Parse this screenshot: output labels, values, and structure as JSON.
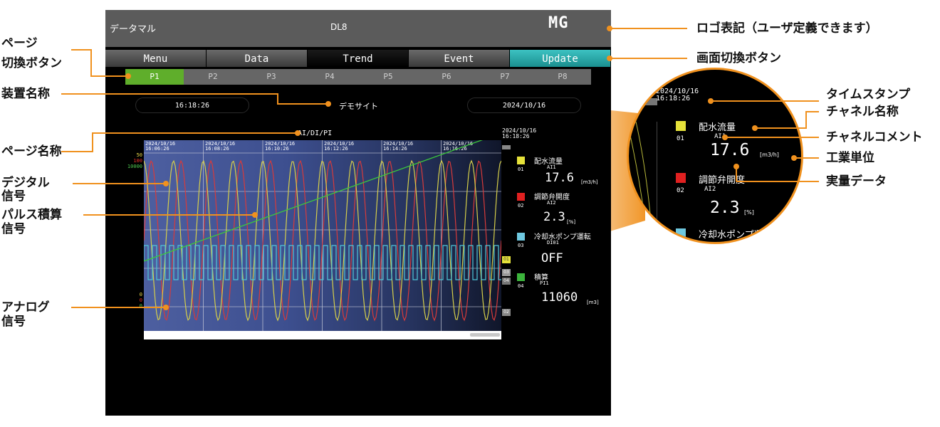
{
  "screen": {
    "app_name": "データマル",
    "device_code": "DL8",
    "logo": "MG",
    "tabs": [
      {
        "label": "Menu"
      },
      {
        "label": "Data"
      },
      {
        "label": "Trend"
      },
      {
        "label": "Event"
      },
      {
        "label": "Update"
      }
    ],
    "active_tab": "Trend",
    "pages": [
      "P1",
      "P2",
      "P3",
      "P4",
      "P5",
      "P6",
      "P7",
      "P8"
    ],
    "active_page": "P1",
    "time": "16:18:26",
    "site_name": "デモサイト",
    "date": "2024/10/16",
    "page_name": "AI/DI/PI",
    "trend": {
      "timestamps": [
        {
          "date": "2024/10/16",
          "time": "16:06:26"
        },
        {
          "date": "2024/10/16",
          "time": "16:08:26"
        },
        {
          "date": "2024/10/16",
          "time": "16:10:26"
        },
        {
          "date": "2024/10/16",
          "time": "16:12:26"
        },
        {
          "date": "2024/10/16",
          "time": "16:14:26"
        },
        {
          "date": "2024/10/16",
          "time": "16:16:26"
        }
      ],
      "scale_top": [
        "50",
        "100",
        "10000"
      ],
      "scale_bottom": [
        "0",
        "0",
        "0"
      ],
      "scale_colors": [
        "#e8d84a",
        "#e8302a",
        "#50c850"
      ],
      "markers": [
        "01",
        "03",
        "04",
        "02"
      ]
    },
    "legend": {
      "timestamp_date": "2024/10/16",
      "timestamp_time": "16:18:26",
      "channels": [
        {
          "num": "01",
          "color": "#e6e23a",
          "name": "配水流量",
          "comment": "AI1",
          "value": "17.6",
          "unit": "[m3/h]"
        },
        {
          "num": "02",
          "color": "#e02020",
          "name": "調節弁開度",
          "comment": "AI2",
          "value": "2.3",
          "unit": "[%]"
        },
        {
          "num": "03",
          "color": "#6ec8e0",
          "name": "冷却水ポンプ運転",
          "comment": "DI01",
          "value": "OFF",
          "unit": ""
        },
        {
          "num": "04",
          "color": "#3cb43c",
          "name": "積算",
          "comment": "PI1",
          "value": "11060",
          "unit": "[m3]"
        }
      ]
    }
  },
  "callouts": {
    "logo": "ロゴ表記（ユーザ定義できます）",
    "screen_switch": "画面切換ボタン",
    "page_switch_1": "ページ",
    "page_switch_2": "切換ボタン",
    "device_name": "装置名称",
    "page_name": "ページ名称",
    "digital_1": "デジタル",
    "digital_2": "信号",
    "pulse_1": "パルス積算",
    "pulse_2": "信号",
    "analog_1": "アナログ",
    "analog_2": "信号",
    "timestamp": "タイムスタンプ",
    "channel_name": "チャネル名称",
    "channel_comment": "チャネルコメント",
    "unit": "工業単位",
    "measured": "実量データ"
  },
  "colors": {
    "accent": "#f0911e",
    "screen_bg": "#000000",
    "title_bg": "#5b5b5b",
    "page_active": "#5fae2b",
    "update_tab": "#2aa8a8"
  }
}
